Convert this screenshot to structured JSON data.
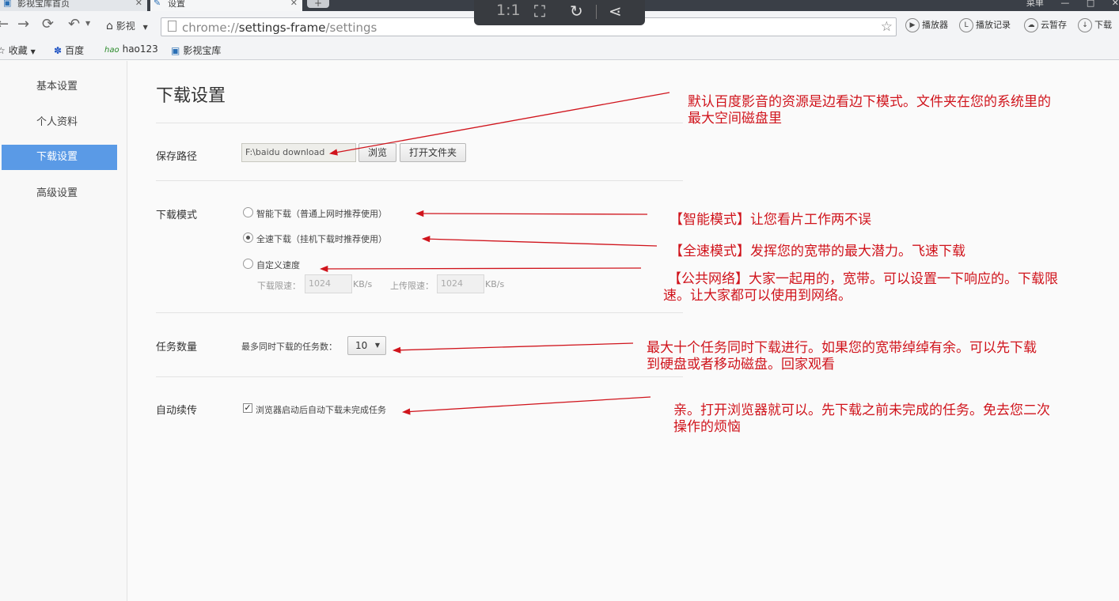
{
  "browser": {
    "tabs": [
      {
        "title": "影视宝库首页",
        "icon": "film-icon"
      },
      {
        "title": "设置",
        "icon": "wrench-icon"
      }
    ],
    "window_label": "菜单",
    "home_label": "影视",
    "url_prefix": "chrome://",
    "url_host": "settings-frame",
    "url_path": "/settings",
    "right_buttons": [
      {
        "label": "播放器",
        "icon": "play-icon"
      },
      {
        "label": "播放记录",
        "icon": "history-icon"
      },
      {
        "label": "云暂存",
        "icon": "cloud-icon"
      },
      {
        "label": "下载",
        "icon": "download-icon"
      }
    ],
    "bookmarks": [
      {
        "label": "收藏",
        "icon": "star-icon"
      },
      {
        "label": "百度",
        "icon": "baidu-paw-icon"
      },
      {
        "label": "hao123",
        "icon": "hao123-icon"
      },
      {
        "label": "影视宝库",
        "icon": "film-icon"
      }
    ]
  },
  "viewer": {
    "zoom_label": "1:1"
  },
  "sidebar": {
    "items": [
      {
        "label": "基本设置",
        "active": false
      },
      {
        "label": "个人资料",
        "active": false
      },
      {
        "label": "下载设置",
        "active": true
      },
      {
        "label": "高级设置",
        "active": false
      }
    ]
  },
  "main": {
    "title": "下载设置",
    "save_path": {
      "label": "保存路径",
      "value": "F:\\baidu download",
      "browse_button": "浏览",
      "open_folder_button": "打开文件夹"
    },
    "download_mode": {
      "label": "下载模式",
      "options": [
        {
          "label": "智能下载（普通上网时推荐使用）",
          "selected": false
        },
        {
          "label": "全速下载（挂机下载时推荐使用）",
          "selected": true
        },
        {
          "label": "自定义速度",
          "selected": false
        }
      ],
      "download_limit_label": "下载限速：",
      "download_limit_value": "1024",
      "download_unit": "KB/s",
      "upload_limit_label": "上传限速：",
      "upload_limit_value": "1024",
      "upload_unit": "KB/s"
    },
    "task_count": {
      "label": "任务数量",
      "prompt": "最多同时下载的任务数：",
      "value": "10"
    },
    "auto_resume": {
      "label": "自动续传",
      "checkbox_label": "浏览器启动后自动下载未完成任务",
      "checked": true
    }
  },
  "annotations": {
    "color": "#d0141c",
    "notes": [
      [
        "默认百度影音的资源是边看边下模式。文件夹在您的系统里的",
        "最大空间磁盘里"
      ],
      [
        "【智能模式】让您看片工作两不误"
      ],
      [
        "【全速模式】发挥您的宽带的最大潜力。飞速下载"
      ],
      [
        "【公共网络】大家一起用的，宽带。可以设置一下响应的。下载限",
        "速。让大家都可以使用到网络。"
      ],
      [
        "最大十个任务同时下载进行。如果您的宽带绰绰有余。可以先下载",
        "到硬盘或者移动磁盘。回家观看"
      ],
      [
        "亲。打开浏览器就可以。先下载之前未完成的任务。免去您二次",
        "操作的烦恼"
      ]
    ]
  }
}
